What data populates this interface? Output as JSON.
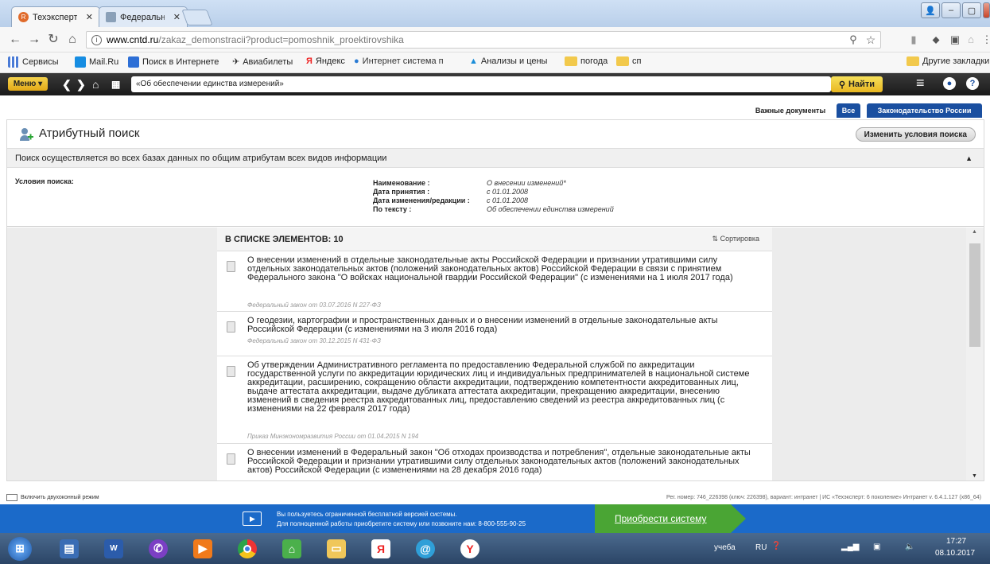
{
  "browser": {
    "tabs": [
      {
        "label": "Техэксперт - Заказать д",
        "active": true
      },
      {
        "label": "Федеральный закон \"О",
        "active": false
      }
    ],
    "url_host": "www.cntd.ru",
    "url_path": "/zakaz_demonstracii?product=pomoshnik_proektirovshika",
    "bookmarks": [
      {
        "label": "Сервисы",
        "icon": "apps-grid-icon"
      },
      {
        "label": "Mail.Ru",
        "icon": "mailru-icon"
      },
      {
        "label": "Поиск в Интернете",
        "icon": "search-icon"
      },
      {
        "label": "Авиабилеты",
        "icon": "plane-icon"
      },
      {
        "label": "Яндекс",
        "icon": "yandex-icon"
      },
      {
        "label": "Интернет система п",
        "icon": "system-icon"
      },
      {
        "label": "Анализы и цены",
        "icon": "lab-icon"
      },
      {
        "label": "погода",
        "icon": "folder-icon"
      },
      {
        "label": "сп",
        "icon": "folder-icon"
      }
    ],
    "other_bookmarks": "Другие закладки"
  },
  "app": {
    "menu_label": "Меню",
    "search_value": "«Об обеспечении единства измерений»",
    "find_label": "Найти",
    "doc_tabs": [
      "Важные документы",
      "Все",
      "Законодательство России"
    ]
  },
  "attr": {
    "title": "Атрибутный поиск",
    "modify_label": "Изменить условия поиска",
    "info_text": "Поиск осуществляется во всех базах данных по общим атрибутам всех видов информации",
    "conditions_label": "Условия поиска:",
    "conditions": [
      {
        "key": "Наименование :",
        "value": "О внесении изменений*"
      },
      {
        "key": "Дата принятия :",
        "value": "с 01.01.2008"
      },
      {
        "key": "Дата изменения/редакции :",
        "value": "с 01.01.2008"
      },
      {
        "key": "По тексту :",
        "value": "Об обеспечении единства измерений"
      }
    ]
  },
  "list": {
    "count_label": "В СПИСКЕ ЭЛЕМЕНТОВ: 10",
    "sort_label": "Сортировка",
    "items": [
      {
        "title": "О внесении изменений в отдельные законодательные акты Российской Федерации и признании утратившими силу отдельных законодательных актов (положений законодательных актов) Российской Федерации в связи с принятием Федерального закона \"О войсках национальной гвардии Российской Федерации\" (с изменениями на 1 июля 2017 года)",
        "sub": "Федеральный закон от 03.07.2016 N 227-ФЗ"
      },
      {
        "title": "О геодезии, картографии и пространственных данных и о внесении изменений в отдельные законодательные акты Российской Федерации (с изменениями на 3 июля 2016 года)",
        "sub": "Федеральный закон от 30.12.2015 N 431-ФЗ"
      },
      {
        "title": "Об утверждении Административного регламента по предоставлению Федеральной службой по аккредитации государственной услуги по аккредитации юридических лиц и индивидуальных предпринимателей в национальной системе аккредитации, расширению, сокращению области аккредитации, подтверждению компетентности аккредитованных лиц, выдаче аттестата аккредитации, выдаче дубликата аттестата аккредитации, прекращению аккредитации, внесению изменений в сведения реестра аккредитованных лиц, предоставлению сведений из реестра аккредитованных лиц (с изменениями на 22 февраля 2017 года)",
        "sub": "Приказ Минэкономразвития России от 01.04.2015 N 194"
      },
      {
        "title": "О внесении изменений в Федеральный закон \"Об отходах производства и потребления\", отдельные законодательные акты Российской Федерации и признании утратившими силу отдельных законодательных актов (положений законодательных актов) Российской Федерации (с изменениями на 28 декабря 2016 года)",
        "sub": ""
      }
    ]
  },
  "status": {
    "left": "Включить двухоконный режим",
    "right": "Рег. номер: 746_226398 (ключ: 226398), вариант: интранет  |  ИС «Техэксперт: 6 поколение» Интранет v. 6.4.1.127 (x86_64)"
  },
  "promo": {
    "line1": "Вы пользуетесь ограниченной бесплатной версией системы.",
    "line2": "Для полноценной работы приобретите систему или позвоните нам: 8-800-555-90-25",
    "buy_label": "Приобрести систему"
  },
  "taskbar": {
    "lang_bar": "учеба",
    "lang": "RU",
    "time": "17:27",
    "date": "08.10.2017"
  },
  "colors": {
    "accent_yellow": "#f4d24d",
    "promo_blue": "#1b6ac9",
    "buy_green": "#4aa534"
  }
}
